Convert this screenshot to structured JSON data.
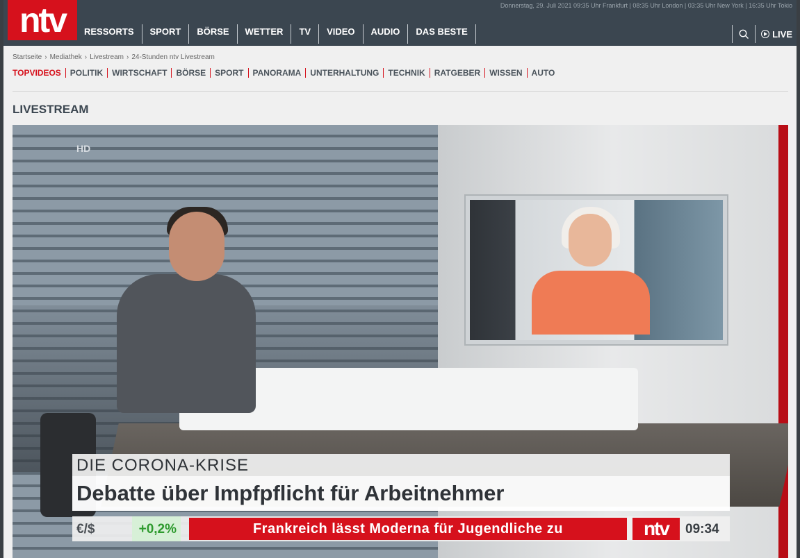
{
  "header": {
    "topline": "Donnerstag, 29. Juli 2021 09:35 Uhr Frankfurt | 08:35 Uhr London | 03:35 Uhr New York | 16:35 Uhr Tokio",
    "logo": "ntv",
    "nav": [
      "RESSORTS",
      "SPORT",
      "BÖRSE",
      "WETTER",
      "TV",
      "VIDEO",
      "AUDIO",
      "DAS BESTE"
    ],
    "live_label": "LIVE"
  },
  "breadcrumb": [
    "Startseite",
    "Mediathek",
    "Livestream",
    "24-Stunden ntv Livestream"
  ],
  "subnav": [
    "TOPVIDEOS",
    "POLITIK",
    "WIRTSCHAFT",
    "BÖRSE",
    "SPORT",
    "PANORAMA",
    "UNTERHALTUNG",
    "TECHNIK",
    "RATGEBER",
    "WISSEN",
    "AUTO"
  ],
  "section_title": "LIVESTREAM",
  "player": {
    "hd_badge": "HD",
    "topic": "DIE CORONA-KRISE",
    "headline": "Debatte über Impfpflicht für Arbeitnehmer",
    "ticker": {
      "currency": "€/$",
      "change": "+0,2%",
      "news": "Frankreich lässt Moderna für Jugendliche zu",
      "logo": "ntv",
      "time": "09:34"
    }
  }
}
